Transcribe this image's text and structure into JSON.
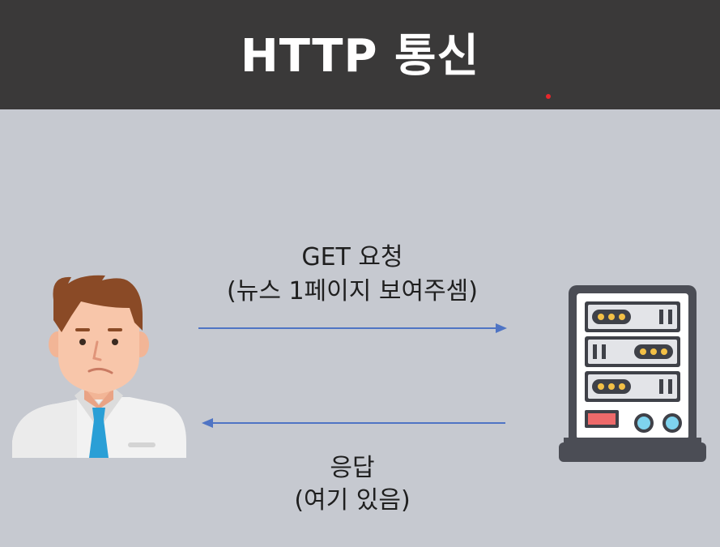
{
  "header": {
    "title": "HTTP 통신"
  },
  "request": {
    "line1": "GET 요청",
    "line2": "(뉴스 1페이지 보여주셈)"
  },
  "response": {
    "line1": "응답",
    "line2": "(여기 있음)"
  },
  "icons": {
    "client": "person-icon",
    "server": "server-rack-icon"
  },
  "colors": {
    "header_bg": "#3a3939",
    "canvas_bg": "#c6c9d0",
    "arrow": "#4f74c4",
    "pointer": "#e8262b"
  }
}
